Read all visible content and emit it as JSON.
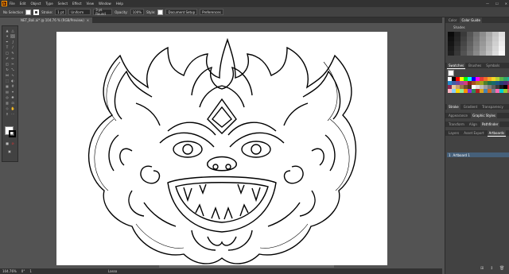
{
  "app": {
    "logo": "Ai"
  },
  "menu": [
    "File",
    "Edit",
    "Object",
    "Type",
    "Select",
    "Effect",
    "View",
    "Window",
    "Help"
  ],
  "window_controls": {
    "minimize": "—",
    "maximize": "☐",
    "close": "✕"
  },
  "control_bar": {
    "selection": "No Selection",
    "stroke_label": "Stroke:",
    "stroke_value": "1 pt",
    "profile": "Uniform",
    "brush": "3 pt. Round",
    "opacity_label": "Opacity:",
    "opacity_value": "100%",
    "style_label": "Style:",
    "doc_setup": "Document Setup",
    "preferences": "Preferences"
  },
  "document_tab": {
    "title": "NET_Bali.ai* @ 104.76 % (RGB/Preview)",
    "close": "×"
  },
  "status_bar": {
    "zoom": "104.76%",
    "angle": "0°",
    "artboard": "1",
    "tool": "Lasso"
  },
  "panels": {
    "top_tabs": [
      "Color",
      "Color Guide"
    ],
    "harmony_label": "Shades",
    "swatches_tabs": [
      "Swatches",
      "Brushes",
      "Symbols"
    ],
    "mid_tabs": [
      "Stroke",
      "Gradient",
      "Transparency"
    ],
    "appearance_tabs": [
      "Appearance",
      "Graphic Styles"
    ],
    "transform_tabs": [
      "Transform",
      "Align",
      "Pathfinder"
    ],
    "layers_tabs": [
      "Layers",
      "Asset Export",
      "Artboards"
    ],
    "artboard_row": {
      "index": "1",
      "name": "Artboard 1"
    }
  },
  "colors": {
    "accent": "#ff9a00",
    "panel_bg": "#424242",
    "canvas_bg": "#535353",
    "artboard": "#ffffff",
    "selected_row": "#46607a"
  },
  "swatch_colors": [
    "#ffffff",
    "#000000",
    "#ff0000",
    "#ffff00",
    "#00ff00",
    "#00ffff",
    "#0000ff",
    "#ff00ff",
    "#e83a3a",
    "#f36b2b",
    "#f7a823",
    "#f7d524",
    "#b5d334",
    "#5cb947",
    "#30a867",
    "#1eaaa1",
    "#2489c9",
    "#3c5fab",
    "#6c4a9d",
    "#a3479b",
    "#d43e7c",
    "#8b1e1e",
    "#a8501c",
    "#b0821a",
    "#9fa31e",
    "#507f2c",
    "#1f6e47",
    "#176b69",
    "#1b5885",
    "#283e7a",
    "#482f74",
    "#71296c",
    "#8e2752",
    "#e6c9a0",
    "#c7a26d",
    "#9c7645",
    "#6d512f",
    "#4a3520",
    "#ffffff",
    "#e0e0e0",
    "#bfbfbf",
    "#9e9e9e",
    "#7d7d7d",
    "#5c5c5c",
    "#3b3b3b",
    "#1a1a1a",
    "#000000",
    "#c8102e",
    "#ffb6c1",
    "#87cefa",
    "#ffd700",
    "#90ee90",
    "#ff8c00",
    "#8a2be2",
    "#2e8b57",
    "#b22222",
    "#daa520",
    "#4682b4",
    "#d2691e",
    "#708090",
    "#ff69b4",
    "#00ced1",
    "#9acd32",
    "#cd5c5c"
  ]
}
